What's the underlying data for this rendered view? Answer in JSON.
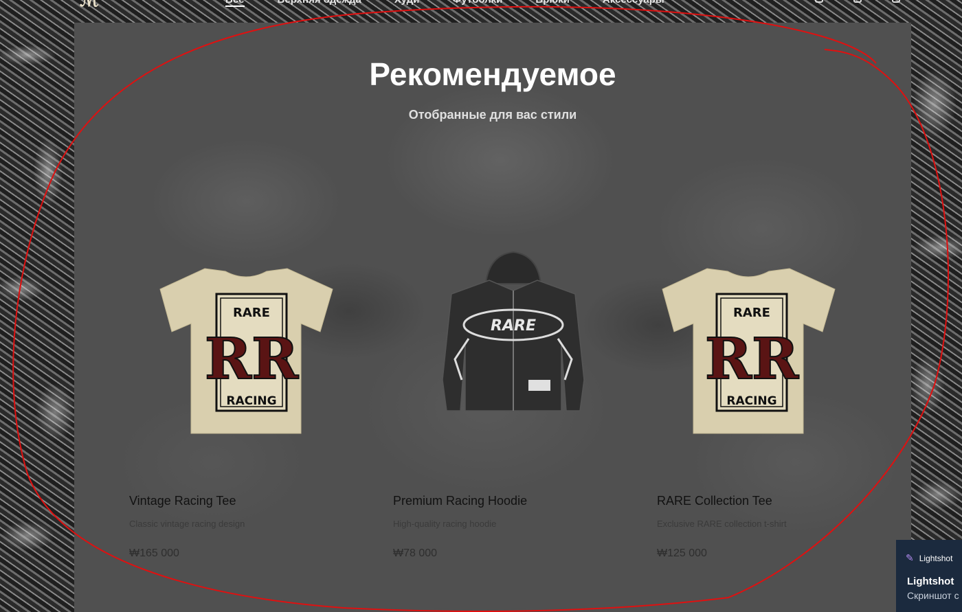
{
  "header": {
    "logo": "ℳ",
    "nav": [
      "Все",
      "Верхняя одежда",
      "Худи",
      "Футболки",
      "Брюки",
      "Аксессуары"
    ],
    "active_index": 0
  },
  "section": {
    "title": "Рекомендуемое",
    "subtitle": "Отобранные для вас стили"
  },
  "products": [
    {
      "name": "Vintage Racing Tee",
      "description": "Classic vintage racing design",
      "price": "₩165 000",
      "image": "rare-racing-tee"
    },
    {
      "name": "Premium Racing Hoodie",
      "description": "High-quality racing hoodie",
      "price": "₩78 000",
      "image": "rare-racing-hoodie"
    },
    {
      "name": "RARE Collection Tee",
      "description": "Exclusive RARE collection t-shirt",
      "price": "₩125 000",
      "image": "rare-racing-tee"
    }
  ],
  "tee_print": {
    "top": "RARE",
    "monogram": "RR",
    "bottom": "RACING"
  },
  "hoodie_print": "RARE",
  "toast": {
    "app": "Lightshot",
    "title": "Lightshot",
    "text": "Скриншот с"
  },
  "colors": {
    "tee": "#d9cfae",
    "hoodie": "#2c2c2c",
    "annotation": "#e01010",
    "toast_bg": "#1b2a3e"
  }
}
